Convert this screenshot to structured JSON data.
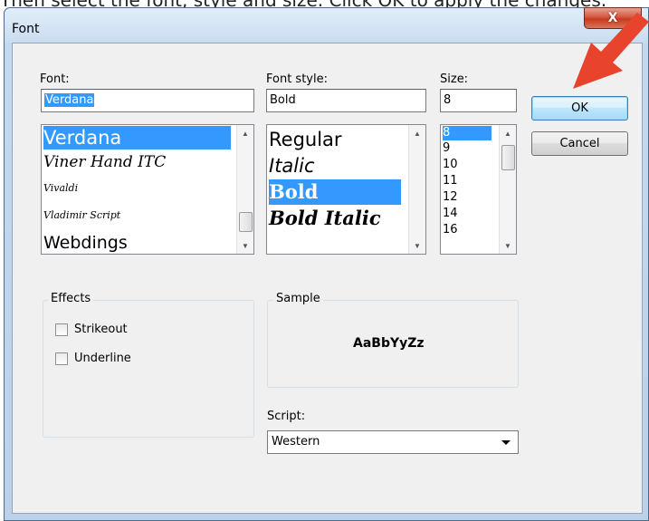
{
  "caption": "Then select the font, style and size. Click OK to apply the changes.",
  "window": {
    "title": "Font",
    "close_glyph": "X"
  },
  "font": {
    "label": "Font:",
    "value": "Verdana",
    "items": [
      "Verdana",
      "Viner Hand ITC",
      "Vivaldi",
      "Vladimir Script",
      "Webdings"
    ],
    "selected_index": 0
  },
  "style": {
    "label": "Font style:",
    "value": "Bold",
    "items": [
      "Regular",
      "Italic",
      "Bold",
      "Bold Italic"
    ],
    "selected_index": 2
  },
  "size": {
    "label": "Size:",
    "value": "8",
    "items": [
      "8",
      "9",
      "10",
      "11",
      "12",
      "14",
      "16"
    ],
    "selected_index": 0
  },
  "buttons": {
    "ok": "OK",
    "cancel": "Cancel"
  },
  "effects": {
    "title": "Effects",
    "strikeout": "Strikeout",
    "underline": "Underline"
  },
  "sample": {
    "title": "Sample",
    "text": "AaBbYyZz"
  },
  "script": {
    "label": "Script:",
    "value": "Western"
  },
  "colors": {
    "selection": "#3399ff",
    "arrow": "#e8432c"
  },
  "icons": {
    "scroll_up": "scroll-up-arrow-icon",
    "scroll_down": "scroll-down-arrow-icon",
    "dropdown": "chevron-down-icon",
    "pointer": "red-arrow-icon"
  }
}
